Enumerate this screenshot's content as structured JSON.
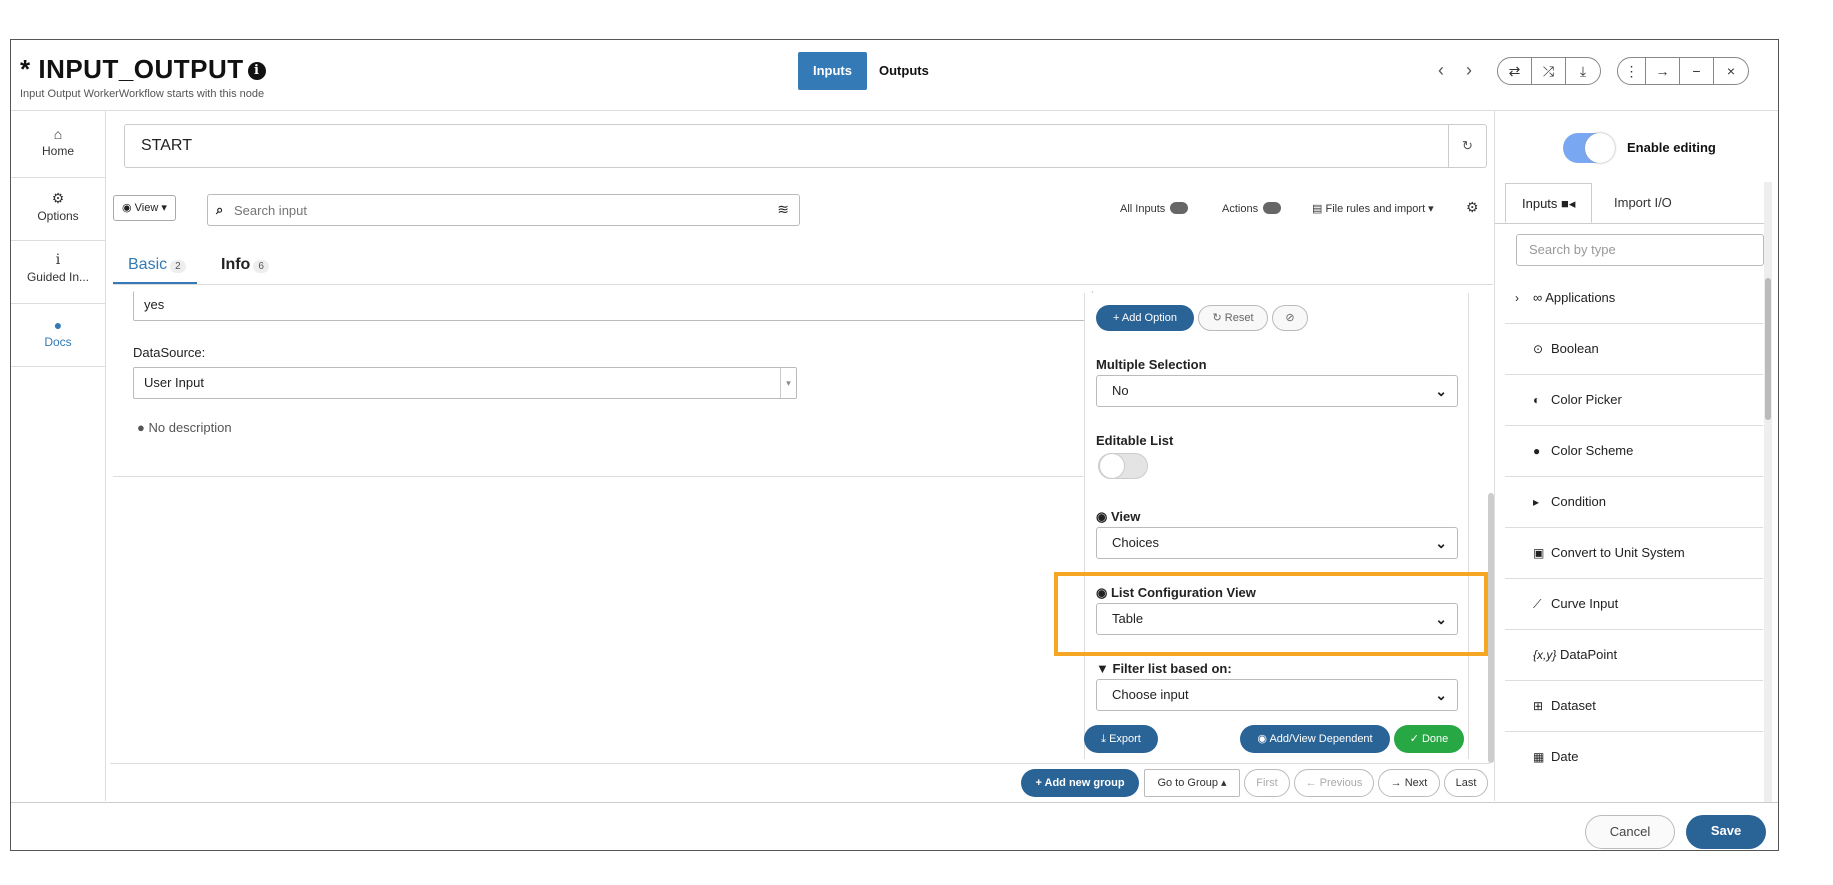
{
  "header": {
    "title_prefix": "* ",
    "title": "INPUT_OUTPUT",
    "subtitle": "Input Output WorkerWorkflow starts with this node",
    "tab_inputs": "Inputs",
    "tab_outputs": "Outputs"
  },
  "nav": [
    {
      "label": "Home",
      "icon": "home-icon"
    },
    {
      "label": "Options",
      "icon": "gear-icon"
    },
    {
      "label": "Guided In...",
      "icon": "info-icon"
    },
    {
      "label": "Docs",
      "icon": "info-circle-icon"
    }
  ],
  "main": {
    "start_value": "START",
    "view_label": "View",
    "search_placeholder": "Search input",
    "all_inputs": "All Inputs",
    "actions": "Actions",
    "file_rules": "File rules and import",
    "tabs": [
      {
        "label": "Basic",
        "count": "2"
      },
      {
        "label": "Info",
        "count": "6"
      }
    ],
    "yes_value": "yes",
    "datasource_label": "DataSource:",
    "datasource_value": "User Input",
    "no_description": "No description"
  },
  "panel": {
    "add_option": "+ Add Option",
    "reset": "Reset",
    "multiple_selection_label": "Multiple Selection",
    "multiple_selection_value": "No",
    "editable_list_label": "Editable List",
    "view_label": "View",
    "view_value": "Choices",
    "list_config_label": "List Configuration View",
    "list_config_value": "Table",
    "filter_label": "Filter list based on:",
    "filter_value": "Choose input",
    "export": "Export",
    "add_view_dependent": "Add/View Dependent",
    "done": "Done",
    "highlight_color": "#f5a623"
  },
  "pager": {
    "add_group": "+ Add new group",
    "go_to_group": "Go to Group",
    "first": "First",
    "previous": "Previous",
    "next": "Next",
    "last": "Last"
  },
  "sidebar": {
    "enable_editing": "Enable editing",
    "tab_inputs": "Inputs",
    "tab_import": "Import I/O",
    "search_placeholder": "Search by type",
    "types": [
      {
        "label": "Applications",
        "icon": "link-icon"
      },
      {
        "label": "Boolean",
        "icon": "toggle-icon"
      },
      {
        "label": "Color Picker",
        "icon": "contrast-icon"
      },
      {
        "label": "Color Scheme",
        "icon": "palette-icon"
      },
      {
        "label": "Condition",
        "icon": "gavel-icon"
      },
      {
        "label": "Convert to Unit System",
        "icon": "unit-icon"
      },
      {
        "label": "Curve Input",
        "icon": "chart-line-icon"
      },
      {
        "label": "DataPoint",
        "icon": "xy-icon",
        "prefix": "{x,y}"
      },
      {
        "label": "Dataset",
        "icon": "table-icon"
      },
      {
        "label": "Date",
        "icon": "calendar-icon"
      }
    ]
  },
  "footer": {
    "cancel": "Cancel",
    "save": "Save"
  }
}
